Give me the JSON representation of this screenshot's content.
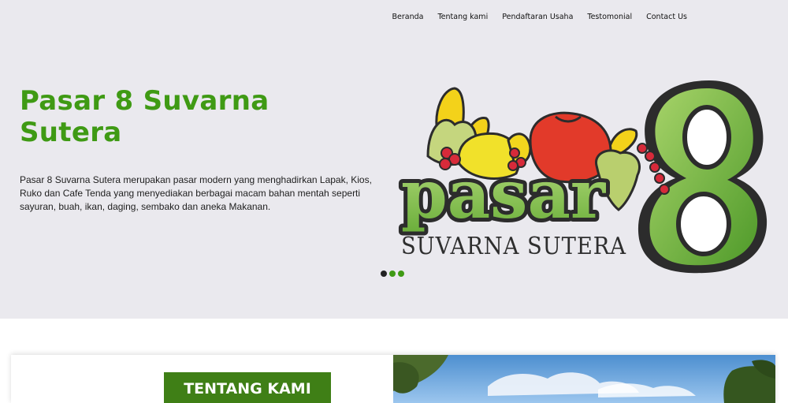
{
  "nav": {
    "items": [
      {
        "label": "Beranda"
      },
      {
        "label": "Tentang kami"
      },
      {
        "label": "Pendaftaran Usaha"
      },
      {
        "label": "Testomonial"
      },
      {
        "label": "Contact Us"
      }
    ]
  },
  "hero": {
    "title": "Pasar 8 Suvarna Sutera",
    "description": "Pasar 8 Suvarna Sutera merupakan pasar modern yang menghadirkan Lapak, Kios, Ruko dan Cafe Tenda yang menyediakan berbagai macam bahan mentah seperti sayuran, buah, ikan, daging, sembako dan aneka Makanan.",
    "logo": {
      "word": "pasar",
      "numeral": "8",
      "subtitle": "SUVARNA SUTERA"
    },
    "carousel": {
      "slide_count": 3,
      "active_index": 0
    }
  },
  "about": {
    "heading": "TENTANG KAMI"
  },
  "colors": {
    "brand_green": "#3f9a14",
    "badge_green": "#3f7f16",
    "hero_background": "#eae9ee"
  }
}
